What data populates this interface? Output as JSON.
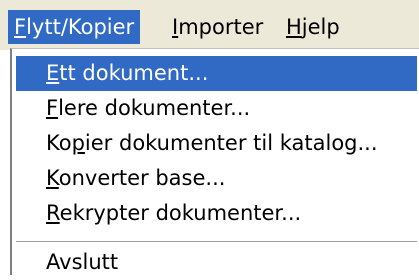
{
  "colors": {
    "menubar_bg": "#ece9d8",
    "highlight_bg": "#316ac5",
    "highlight_fg": "#ffffff",
    "text": "#000000",
    "menu_bg": "#ffffff"
  },
  "menubar": {
    "items": [
      {
        "accel": "F",
        "rest": "lytt/Kopier",
        "active": true
      },
      {
        "accel": "I",
        "rest": "mporter",
        "active": false
      },
      {
        "accel": "H",
        "rest": "jelp",
        "active": false
      }
    ]
  },
  "menu": {
    "items": [
      {
        "accel": "E",
        "rest": "tt dokument...",
        "highlighted": true
      },
      {
        "accel": "F",
        "rest": "lere dokumenter...",
        "highlighted": false
      },
      {
        "pre": "Ko",
        "accel": "p",
        "rest": "ier dokumenter til katalog...",
        "highlighted": false
      },
      {
        "accel": "K",
        "rest": "onverter base...",
        "highlighted": false
      },
      {
        "accel": "R",
        "rest": "ekrypter dokumenter...",
        "highlighted": false
      }
    ],
    "exit": {
      "label": "Avslutt"
    }
  }
}
